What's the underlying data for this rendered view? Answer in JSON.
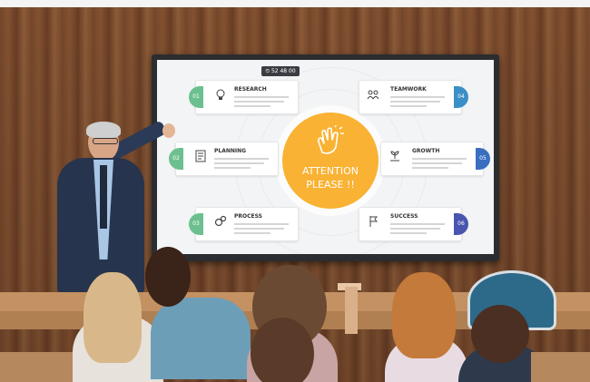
{
  "timer": "52 48 00",
  "center": {
    "line1": "ATTENTION",
    "line2": "PLEASE !!"
  },
  "cards": [
    {
      "num": "01",
      "title": "RESEARCH",
      "color": "#6cc08f",
      "side": "left",
      "icon": "lightbulb-icon"
    },
    {
      "num": "02",
      "title": "PLANNING",
      "color": "#6cc08f",
      "side": "left",
      "icon": "document-icon"
    },
    {
      "num": "03",
      "title": "PROCESS",
      "color": "#6cc08f",
      "side": "left",
      "icon": "gears-icon"
    },
    {
      "num": "04",
      "title": "TEAMWORK",
      "color": "#3a8fc7",
      "side": "right",
      "icon": "team-icon"
    },
    {
      "num": "05",
      "title": "GROWTH",
      "color": "#3a6fc0",
      "side": "right",
      "icon": "plant-hand-icon"
    },
    {
      "num": "06",
      "title": "SUCCESS",
      "color": "#4a55b0",
      "side": "right",
      "icon": "flag-icon"
    }
  ],
  "colors": {
    "accent": "#f9b233",
    "green": "#6cc08f",
    "blue": "#3a6fc0"
  }
}
